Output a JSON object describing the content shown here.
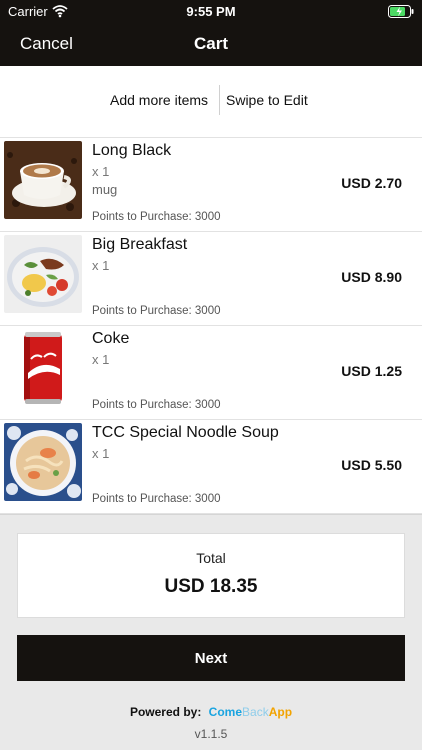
{
  "status_bar": {
    "carrier": "Carrier",
    "time": "9:55 PM",
    "wifi_icon": "wifi-icon",
    "battery_icon": "battery-charging-icon",
    "battery_color": "#4cd964"
  },
  "nav": {
    "cancel_label": "Cancel",
    "title": "Cart"
  },
  "actions": {
    "add_more_label": "Add more items",
    "swipe_label": "Swipe to Edit"
  },
  "items": [
    {
      "name": "Long Black",
      "qty": "x 1",
      "note": "mug",
      "points": "Points to Purchase: 3000",
      "price": "USD 2.70",
      "image": "coffee-cup-image"
    },
    {
      "name": "Big Breakfast",
      "qty": "x 1",
      "note": "",
      "points": "Points to Purchase: 3000",
      "price": "USD 8.90",
      "image": "breakfast-plate-image"
    },
    {
      "name": "Coke",
      "qty": "x 1",
      "note": "",
      "points": "Points to Purchase: 3000",
      "price": "USD 1.25",
      "image": "coke-can-image"
    },
    {
      "name": "TCC Special Noodle Soup",
      "qty": "x 1",
      "note": "",
      "points": "Points to Purchase: 3000",
      "price": "USD 5.50",
      "image": "noodle-soup-image"
    }
  ],
  "summary": {
    "total_label": "Total",
    "total_value": "USD 18.35"
  },
  "next_label": "Next",
  "footer": {
    "powered_label": "Powered by:",
    "brand_part1": "Come",
    "brand_part2": "Back",
    "brand_part3": "App",
    "version": "v1.1.5"
  },
  "colors": {
    "bar_background": "#15120f",
    "brand_blue": "#1aa4e0",
    "brand_orange": "#f2a300"
  }
}
